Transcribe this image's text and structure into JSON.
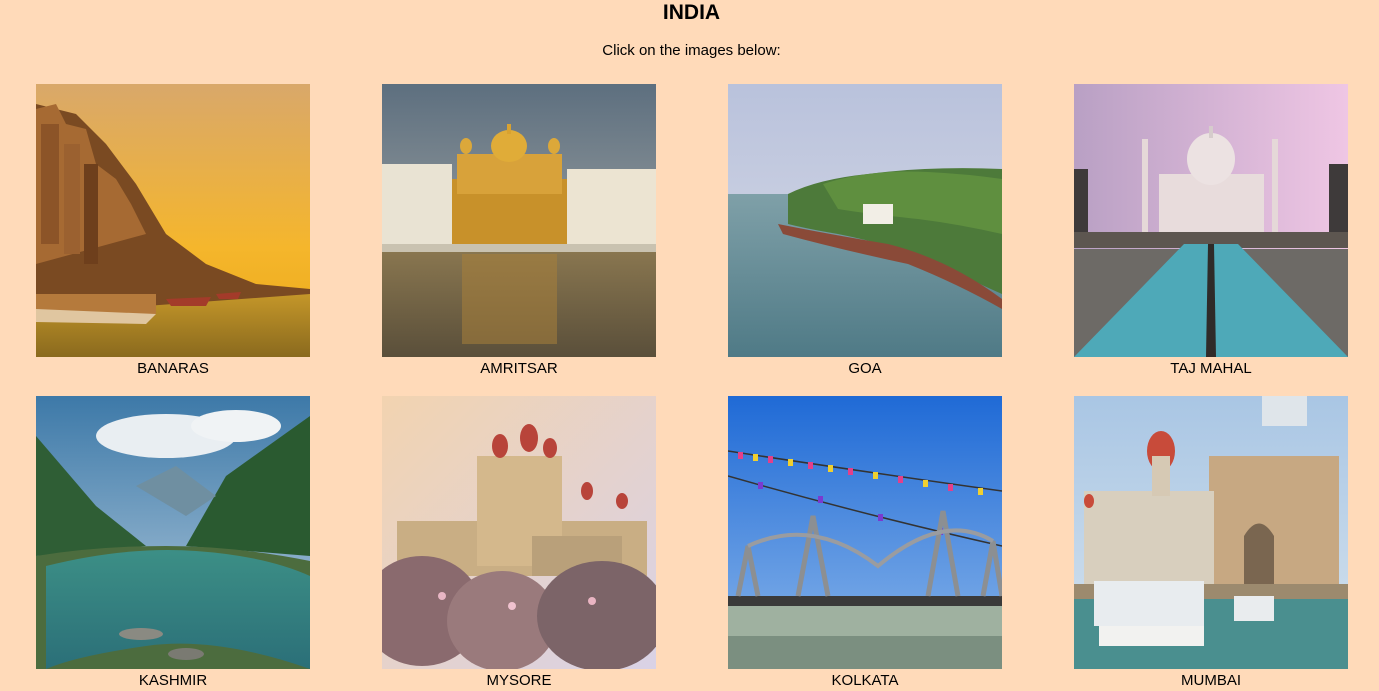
{
  "header": {
    "title": "INDIA",
    "instruction": "Click on the images below:"
  },
  "gallery": {
    "items": [
      {
        "label": "BANARAS"
      },
      {
        "label": "AMRITSAR"
      },
      {
        "label": "GOA"
      },
      {
        "label": "TAJ MAHAL"
      },
      {
        "label": "KASHMIR"
      },
      {
        "label": "MYSORE"
      },
      {
        "label": "KOLKATA"
      },
      {
        "label": "MUMBAI"
      }
    ]
  },
  "colors": {
    "page_background": "#ffdab9"
  }
}
